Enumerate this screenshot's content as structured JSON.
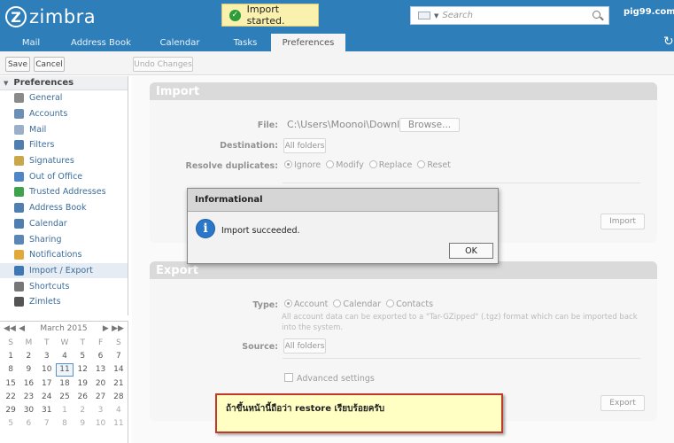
{
  "app": {
    "logo_text": "zimbra",
    "logo_mark": "Z",
    "user": "pig99.com"
  },
  "toast": {
    "text": "Import started."
  },
  "search": {
    "placeholder": "Search"
  },
  "tabs": [
    {
      "label": "Mail"
    },
    {
      "label": "Address Book"
    },
    {
      "label": "Calendar"
    },
    {
      "label": "Tasks"
    },
    {
      "label": "Preferences"
    }
  ],
  "toolbar": {
    "save": "Save",
    "cancel": "Cancel",
    "undo": "Undo Changes"
  },
  "sidebar": {
    "header": "Preferences",
    "items": [
      {
        "label": "General",
        "icon": "gear-icon",
        "color": "#8a8a8a"
      },
      {
        "label": "Accounts",
        "icon": "accounts-icon",
        "color": "#6b8fb5"
      },
      {
        "label": "Mail",
        "icon": "mail-icon",
        "color": "#9bb0c8"
      },
      {
        "label": "Filters",
        "icon": "filter-icon",
        "color": "#4f7fb0"
      },
      {
        "label": "Signatures",
        "icon": "signature-icon",
        "color": "#c9a84a"
      },
      {
        "label": "Out of Office",
        "icon": "out-of-office-icon",
        "color": "#4f86c6"
      },
      {
        "label": "Trusted Addresses",
        "icon": "shield-icon",
        "color": "#3fa34d"
      },
      {
        "label": "Address Book",
        "icon": "address-book-icon",
        "color": "#4f7fb0"
      },
      {
        "label": "Calendar",
        "icon": "calendar-icon",
        "color": "#4f7fb0"
      },
      {
        "label": "Sharing",
        "icon": "sharing-icon",
        "color": "#5a86b8"
      },
      {
        "label": "Notifications",
        "icon": "bell-icon",
        "color": "#e0a93a"
      },
      {
        "label": "Import / Export",
        "icon": "import-export-icon",
        "color": "#3d78b5"
      },
      {
        "label": "Shortcuts",
        "icon": "keyboard-icon",
        "color": "#777777"
      },
      {
        "label": "Zimlets",
        "icon": "zimlet-icon",
        "color": "#555555"
      }
    ]
  },
  "calendar": {
    "month": "March 2015",
    "days": [
      "S",
      "M",
      "T",
      "W",
      "T",
      "F",
      "S"
    ],
    "weeks": [
      [
        "1",
        "2",
        "3",
        "4",
        "5",
        "6",
        "7"
      ],
      [
        "8",
        "9",
        "10",
        "11",
        "12",
        "13",
        "14"
      ],
      [
        "15",
        "16",
        "17",
        "18",
        "19",
        "20",
        "21"
      ],
      [
        "22",
        "23",
        "24",
        "25",
        "26",
        "27",
        "28"
      ],
      [
        "29",
        "30",
        "31",
        "1",
        "2",
        "3",
        "4"
      ],
      [
        "5",
        "6",
        "7",
        "8",
        "9",
        "10",
        "11"
      ]
    ],
    "today": "11"
  },
  "import": {
    "title": "Import",
    "file_label": "File:",
    "file_value": "C:\\Users\\Moonoi\\Downloa",
    "browse": "Browse...",
    "destination_label": "Destination:",
    "destination_value": "All folders",
    "duplicates_label": "Resolve duplicates:",
    "dup_options": [
      "Ignore",
      "Modify",
      "Replace",
      "Reset"
    ],
    "import_button": "Import"
  },
  "export": {
    "title": "Export",
    "type_label": "Type:",
    "type_options": [
      "Account",
      "Calendar",
      "Contacts"
    ],
    "type_hint": "All account data can be exported to a \"Tar-GZipped\" (.tgz) format which can be imported back into the system.",
    "source_label": "Source:",
    "source_value": "All folders",
    "advanced": "Advanced settings",
    "export_button": "Export"
  },
  "dialog": {
    "title": "Informational",
    "message": "Import succeeded.",
    "ok": "OK"
  },
  "note": {
    "text": "ถ้าขึ้นหน้านี้ถือว่า restore เรียบร้อยครับ"
  }
}
